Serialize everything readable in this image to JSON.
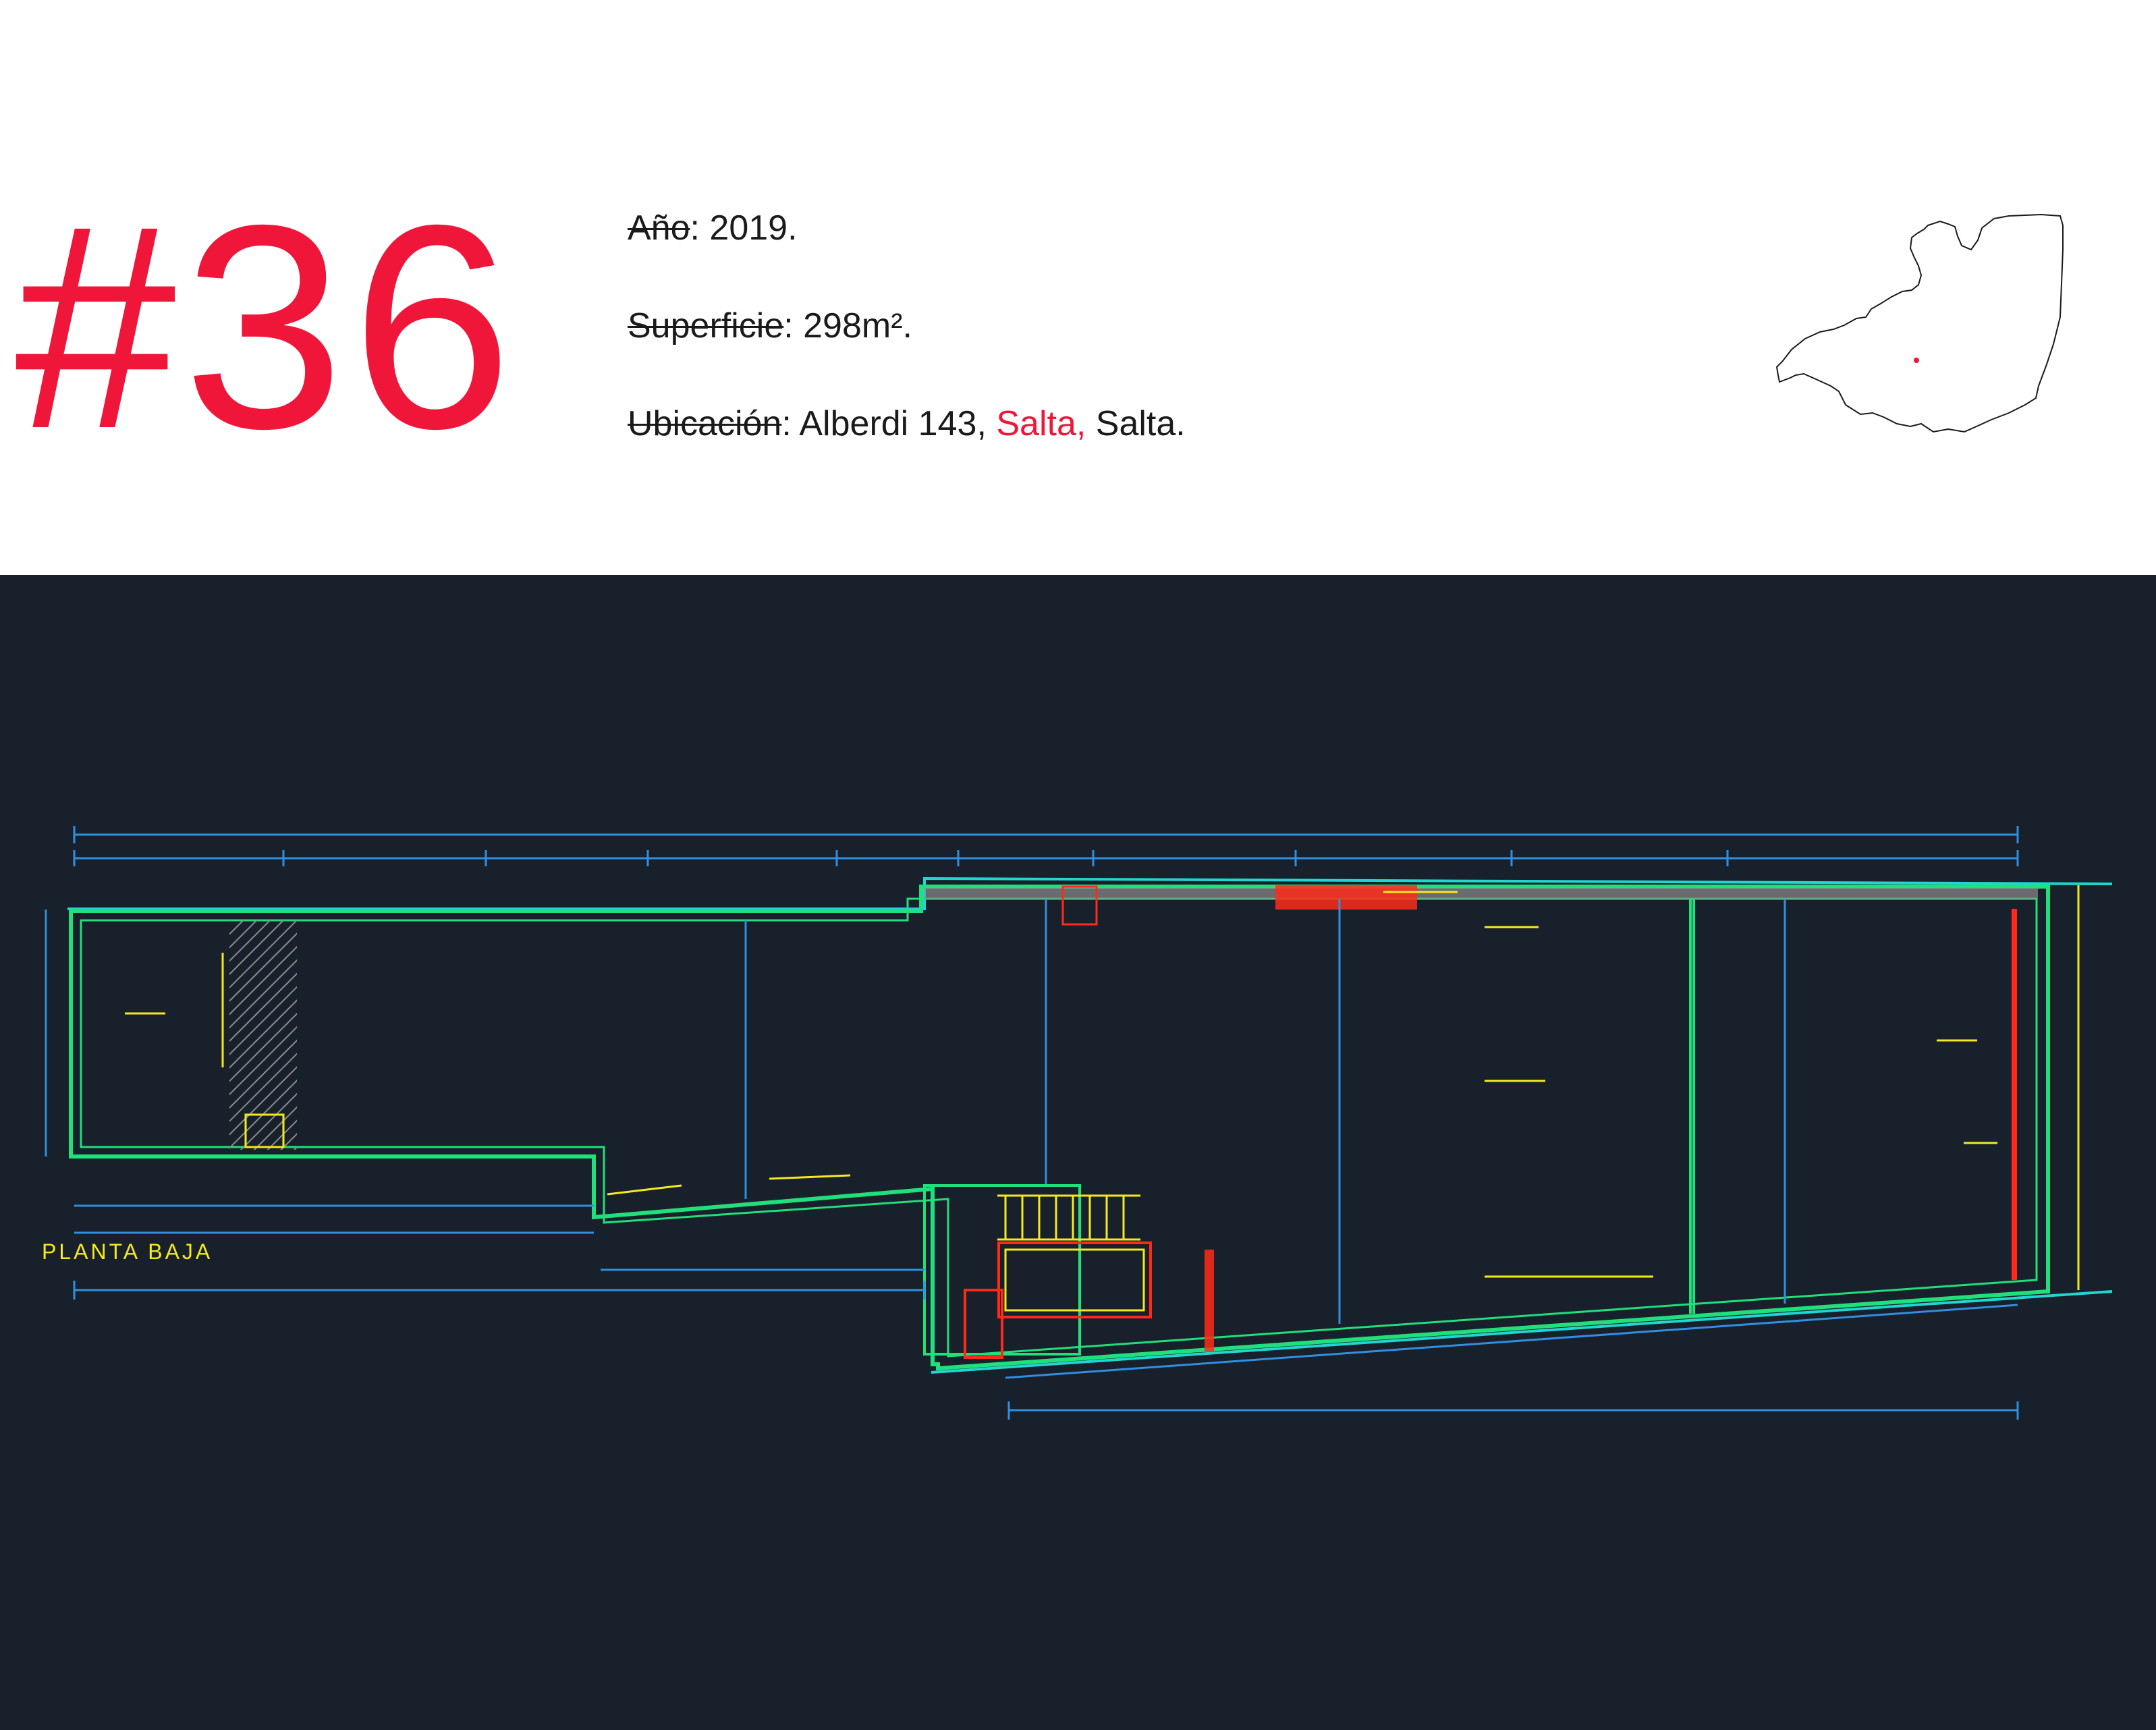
{
  "header": {
    "project_number": "#36",
    "year": {
      "label": "Año",
      "value": ": 2019."
    },
    "surface": {
      "label": "Superficie",
      "value": ": 298m²."
    },
    "location": {
      "label": "Ubicación",
      "address": ": Alberdi 143, ",
      "city": "Salta,",
      "province": " Salta."
    }
  },
  "map": {
    "region": "Salta",
    "accent_color": "#f0163a"
  },
  "plan": {
    "title": "PLANTA BAJA",
    "colors": {
      "background": "#18212b",
      "walls": "#1fe07a",
      "outer_wall": "#1fd6d0",
      "dimensions": "#2f8fe0",
      "annotations": "#f5ea1c",
      "highlight": "#ff2a1a",
      "hatch": "#8c8c8c"
    }
  }
}
